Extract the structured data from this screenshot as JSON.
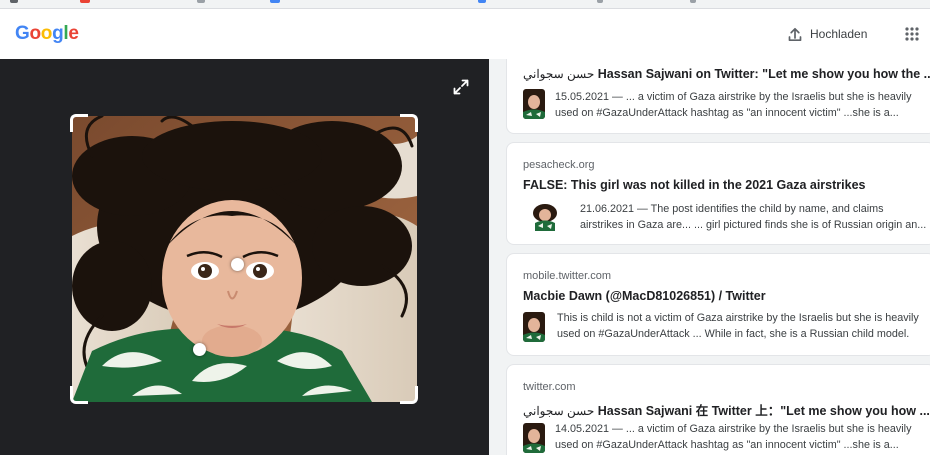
{
  "colors": {
    "google_blue": "#4285F4",
    "google_red": "#EA4335",
    "google_yellow": "#FBBC05",
    "google_green": "#34A853",
    "viewer_background": "#202124",
    "results_background": "#f1f3f4"
  },
  "header": {
    "logo": {
      "letters": [
        "G",
        "o",
        "o",
        "g",
        "l",
        "e"
      ]
    },
    "upload_icon": "upload-icon",
    "upload_label": "Hochladen",
    "apps_icon": "apps-grid-icon"
  },
  "viewer": {
    "expand_icon": "expand-icon",
    "crop_corner_icon": "crop-corner-icon",
    "focus_dot_icon": "focus-dot-icon",
    "image_icon": "photo-girl-icon"
  },
  "results": [
    {
      "source": "",
      "title_arabic": "حسن سجواني",
      "title_main": "Hassan Sajwani on Twitter: \"Let me show you how the ...",
      "date": "15.05.2021",
      "snippet_line1": " — ... a victim of Gaza airstrike by the Israelis but she is heavily",
      "snippet_line2": "used on #GazaUnderAttack hashtag as \"an innocent victim\" ...she is a..."
    },
    {
      "source": "pesacheck.org",
      "title_arabic": "",
      "title_main": "FALSE: This girl was not killed in the 2021 Gaza airstrikes",
      "date": "21.06.2021",
      "snippet_line1": " — The post identifies the child by name, and claims",
      "snippet_line2": "airstrikes in Gaza are... ... girl pictured finds she is of Russian origin an..."
    },
    {
      "source": "mobile.twitter.com",
      "title_arabic": "",
      "title_main": "Macbie Dawn (@MacD81026851) / Twitter",
      "date": "",
      "snippet_line1": "This is child is not a victim of Gaza airstrike by the Israelis but she is heavily",
      "snippet_line2": "used on #GazaUnderAttack ... While in fact, she is a Russian child model."
    },
    {
      "source": "twitter.com",
      "title_arabic": "حسن سجواني",
      "title_main": "Hassan Sajwani 在 Twitter 上：\"Let me show you how ...",
      "date": "14.05.2021",
      "snippet_line1": " — ... a victim of Gaza airstrike by the Israelis but she is heavily",
      "snippet_line2": "used on #GazaUnderAttack hashtag as \"an innocent victim\" ...she is a..."
    }
  ]
}
